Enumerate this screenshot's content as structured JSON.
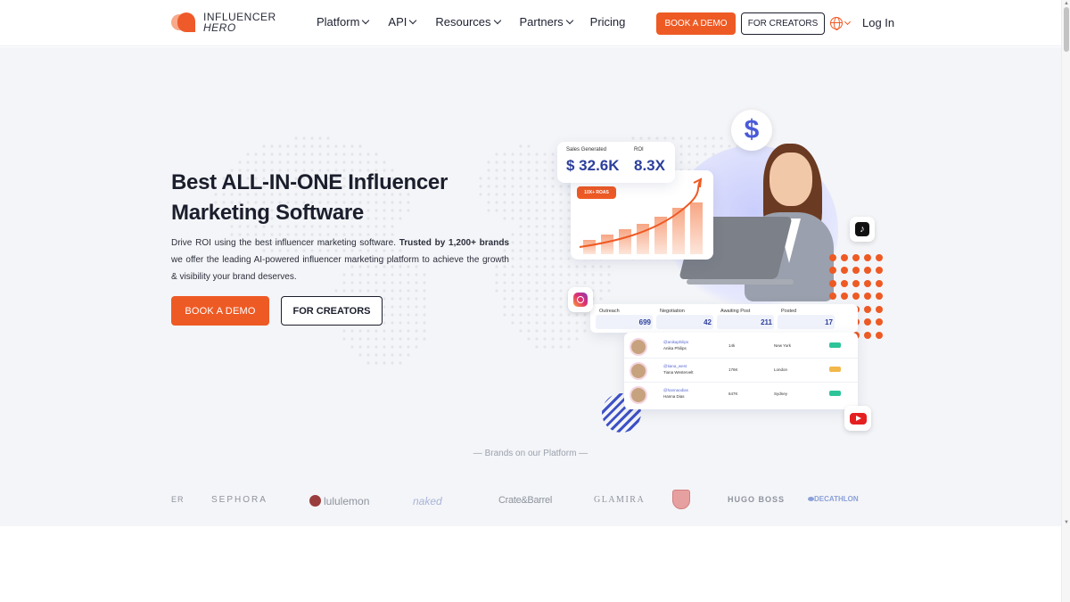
{
  "header": {
    "logo_line1": "INFLUENCER",
    "logo_line2": "HERO",
    "nav": [
      {
        "label": "Platform"
      },
      {
        "label": "API"
      },
      {
        "label": "Resources"
      },
      {
        "label": "Partners"
      }
    ],
    "pricing": "Pricing",
    "book_demo": "BOOK A DEMO",
    "for_creators": "FOR CREATORS",
    "login": "Log In"
  },
  "hero": {
    "title": "Best ALL-IN-ONE Influencer Marketing Software",
    "desc_pre": "Drive ROI using the best influencer marketing software. ",
    "desc_bold": "Trusted by 1,200+ brands",
    "desc_post": " we offer the leading AI-powered influencer marketing platform to achieve the growth & visibility your brand deserves.",
    "book_demo": "BOOK A DEMO",
    "for_creators": "FOR CREATORS"
  },
  "illustration": {
    "sales_label": "Sales Generated",
    "sales_value": "$ 32.6K",
    "roi_label": "ROI",
    "roi_value": "8.3X",
    "roas_badge": "10X+ ROAS",
    "stats": [
      {
        "label": "Outreach",
        "value": "699"
      },
      {
        "label": "Negotiation",
        "value": "42"
      },
      {
        "label": "Awaiting Post",
        "value": "211"
      },
      {
        "label": "Posted",
        "value": "17"
      }
    ],
    "rows": [
      {
        "handle": "@anikaphilips",
        "name": "Anika Philips",
        "followers": "14k",
        "city": "New York",
        "status_color": "#2ec49a"
      },
      {
        "handle": "@tiana_west",
        "name": "Tiana Westervelt",
        "followers": "176K",
        "city": "London",
        "status_color": "#f2b84b"
      },
      {
        "handle": "@hannaodias",
        "name": "Hanna Dias",
        "followers": "647K",
        "city": "Sydney",
        "status_color": "#2ec49a"
      }
    ]
  },
  "brands": {
    "title": "— Brands on our Platform —",
    "items": [
      "ER",
      "SEPHORA",
      "lululemon",
      "naked",
      "Crate&Barrel",
      "GLAMIRA",
      "HUGO BOSS",
      "DECATHLON"
    ]
  },
  "colors": {
    "accent": "#ee5a24",
    "navy": "#2c3f9c",
    "hero_bg": "#f4f5f8"
  }
}
